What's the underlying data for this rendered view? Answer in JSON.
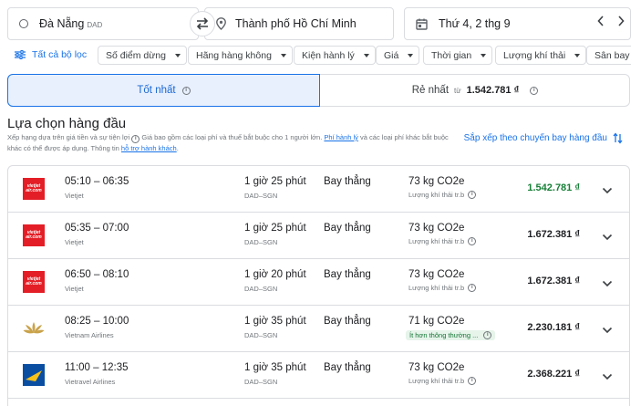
{
  "search": {
    "origin": "Đà Nẵng",
    "origin_code": "DAD",
    "destination": "Thành phố Hồ Chí Minh",
    "date": "Thứ 4, 2 thg 9"
  },
  "filters": {
    "all_label": "Tất cả bộ lọc",
    "chips": [
      "Số điểm dừng",
      "Hãng hàng không",
      "Kiện hành lý",
      "Giá",
      "Thời gian",
      "Lượng khí thải",
      "Sân bay n"
    ]
  },
  "tabs": {
    "best_label": "Tốt nhất",
    "cheapest_label": "Rẻ nhất",
    "cheapest_from": "từ",
    "cheapest_price": "1.542.781 ₫"
  },
  "section": {
    "title": "Lựa chọn hàng đầu",
    "desc_part1": "Xếp hạng dựa trên giá tiền và sự tiện lợi",
    "desc_part2": "Giá bao gồm các loại phí và thuế bắt buộc cho 1 người lớn.",
    "desc_link1": "Phí hành lý",
    "desc_part3": "và các loại phí khác bắt buộc khác có thể được áp dụng. Thông tin",
    "desc_link2": "hỗ trợ hành khách",
    "sort_label": "Sắp xếp theo chuyến bay hàng đầu"
  },
  "flights": [
    {
      "airline": "Vietjet",
      "logo": "vietjet",
      "times": "05:10 – 06:35",
      "duration": "1 giờ 25 phút",
      "route": "DAD–SGN",
      "stops": "Bay thẳng",
      "co2": "73 kg CO2e",
      "co2_note": "Lượng khí thải tr.b",
      "price": "1.542.781 ₫",
      "price_green": true
    },
    {
      "airline": "Vietjet",
      "logo": "vietjet",
      "times": "05:35 – 07:00",
      "duration": "1 giờ 25 phút",
      "route": "DAD–SGN",
      "stops": "Bay thẳng",
      "co2": "73 kg CO2e",
      "co2_note": "Lượng khí thải tr.b",
      "price": "1.672.381 ₫",
      "price_green": false
    },
    {
      "airline": "Vietjet",
      "logo": "vietjet",
      "times": "06:50 – 08:10",
      "duration": "1 giờ 20 phút",
      "route": "DAD–SGN",
      "stops": "Bay thẳng",
      "co2": "73 kg CO2e",
      "co2_note": "Lượng khí thải tr.b",
      "price": "1.672.381 ₫",
      "price_green": false
    },
    {
      "airline": "Vietnam Airlines",
      "logo": "vietnam-airlines",
      "times": "08:25 – 10:00",
      "duration": "1 giờ 35 phút",
      "route": "DAD–SGN",
      "stops": "Bay thẳng",
      "co2": "71 kg CO2e",
      "co2_note": "Ít hơn thông thường ...",
      "price": "2.230.181 ₫",
      "price_green": false
    },
    {
      "airline": "Vietravel Airlines",
      "logo": "vietravel",
      "times": "11:00 – 12:35",
      "duration": "1 giờ 35 phút",
      "route": "DAD–SGN",
      "stops": "Bay thẳng",
      "co2": "73 kg CO2e",
      "co2_note": "Lượng khí thải tr.b",
      "price": "2.368.221 ₫",
      "price_green": false
    }
  ],
  "colors": {
    "accent": "#1a73e8",
    "green": "#188038",
    "vietjet_red": "#e41e26",
    "vietnam_gold": "#c9a24a",
    "vietravel_blue": "#0a4ea2",
    "vietravel_yellow": "#f7c21a"
  }
}
